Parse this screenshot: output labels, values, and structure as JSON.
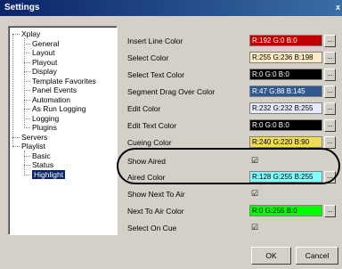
{
  "window": {
    "title": "Settings",
    "close_glyph": "x"
  },
  "tree": {
    "xplay": "Xplay",
    "xplay_children": [
      "General",
      "Layout",
      "Playout",
      "Display",
      "Template Favorites",
      "Panel Events",
      "Automation",
      "As Run Logging",
      "Logging",
      "Plugins"
    ],
    "servers": "Servers",
    "playlist": "Playlist",
    "playlist_children": [
      "Basic",
      "Status",
      "Highlight"
    ],
    "selected": "Highlight"
  },
  "properties": [
    {
      "label": "Insert Line Color",
      "type": "color",
      "value": "R:192 G:0 B:0",
      "color": "#c00000",
      "text_color": "#ffffff"
    },
    {
      "label": "Select Color",
      "type": "color",
      "value": "R:255 G:236 B:198",
      "color": "#ffecc6",
      "text_color": "#000000"
    },
    {
      "label": "Select Text Color",
      "type": "color",
      "value": "R:0 G:0 B:0",
      "color": "#000000",
      "text_color": "#ffffff"
    },
    {
      "label": "Segment Drag Over Color",
      "type": "color",
      "value": "R:47 G:88 B:145",
      "color": "#2f5891",
      "text_color": "#ffffff"
    },
    {
      "label": "Edit Color",
      "type": "color",
      "value": "R:232 G:232 B:255",
      "color": "#e8e8ff",
      "text_color": "#000000"
    },
    {
      "label": "Edit Text Color",
      "type": "color",
      "value": "R:0 G:0 B:0",
      "color": "#000000",
      "text_color": "#ffffff"
    },
    {
      "label": "Cueing Color",
      "type": "color",
      "value": "R:240 G:220 B:90",
      "color": "#f0dc5a",
      "text_color": "#000000"
    },
    {
      "label": "Show Aired",
      "type": "check",
      "checked": true,
      "mark": "☑"
    },
    {
      "label": "Aired Color",
      "type": "color",
      "value": "R:128 G:255 B:255",
      "color": "#80ffff",
      "text_color": "#000000"
    },
    {
      "label": "Show Next To Air",
      "type": "check",
      "checked": true,
      "mark": "☑"
    },
    {
      "label": "Next To Air Color",
      "type": "color",
      "value": "R:0 G:255 B:0",
      "color": "#00ff00",
      "text_color": "#000000"
    },
    {
      "label": "Select On Cue",
      "type": "check",
      "checked": true,
      "mark": "☑"
    }
  ],
  "ellipsis_label": "...",
  "buttons": {
    "ok": "OK",
    "cancel": "Cancel"
  }
}
